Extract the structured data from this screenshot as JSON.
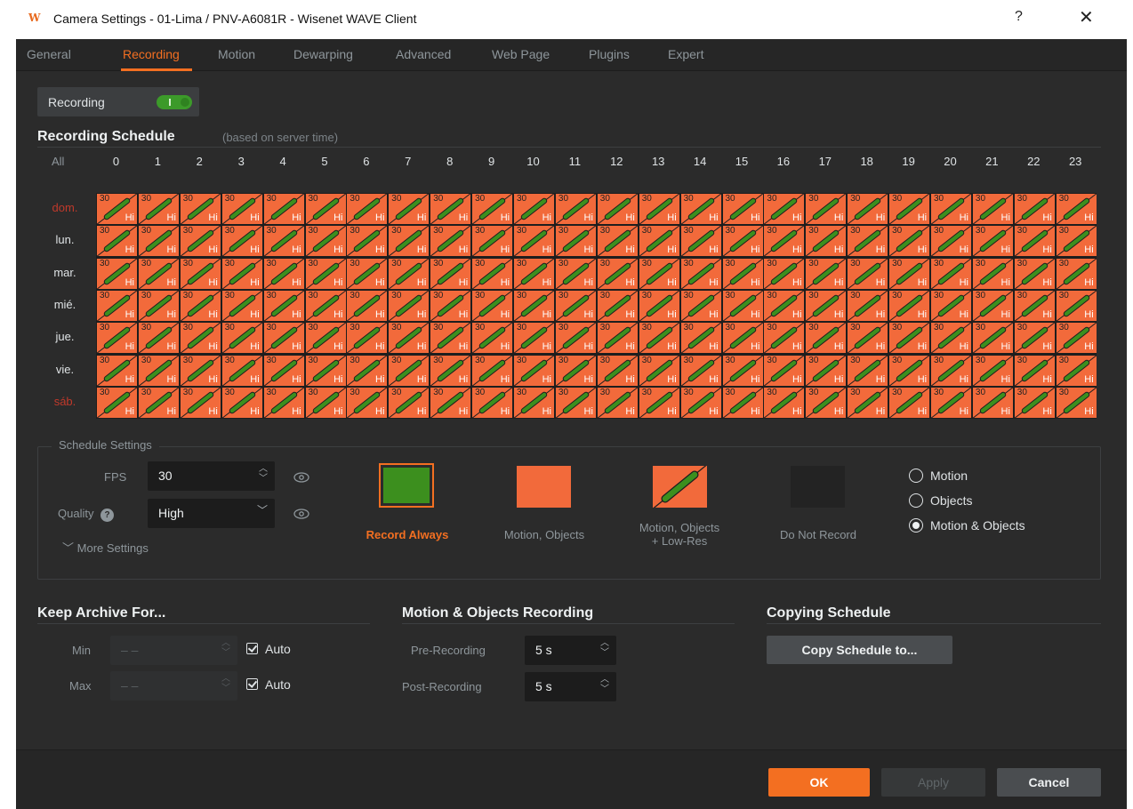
{
  "window": {
    "title": "Camera Settings - 01-Lima / PNV-A6081R - Wisenet WAVE Client",
    "app_icon": "W",
    "help_label": "?",
    "close_label": "✕"
  },
  "tabs": [
    {
      "label": "General",
      "active": false
    },
    {
      "label": "Recording",
      "active": true
    },
    {
      "label": "Motion",
      "active": false
    },
    {
      "label": "Dewarping",
      "active": false
    },
    {
      "label": "Advanced",
      "active": false
    },
    {
      "label": "Web Page",
      "active": false
    },
    {
      "label": "Plugins",
      "active": false
    },
    {
      "label": "Expert",
      "active": false
    }
  ],
  "recording_toggle": {
    "label": "Recording",
    "on": true
  },
  "schedule": {
    "title": "Recording Schedule",
    "subtitle": "(based on server time)",
    "all_label": "All",
    "hours": [
      "0",
      "1",
      "2",
      "3",
      "4",
      "5",
      "6",
      "7",
      "8",
      "9",
      "10",
      "11",
      "12",
      "13",
      "14",
      "15",
      "16",
      "17",
      "18",
      "19",
      "20",
      "21",
      "22",
      "23"
    ],
    "days": [
      {
        "label": "dom.",
        "weekend": true
      },
      {
        "label": "lun.",
        "weekend": false
      },
      {
        "label": "mar.",
        "weekend": false
      },
      {
        "label": "mié.",
        "weekend": false
      },
      {
        "label": "jue.",
        "weekend": false
      },
      {
        "label": "vie.",
        "weekend": false
      },
      {
        "label": "sáb.",
        "weekend": true
      }
    ],
    "cell": {
      "fps": "30",
      "quality": "Hi",
      "mode": "Motion, Objects + Low-Res"
    }
  },
  "schedule_settings": {
    "title": "Schedule Settings",
    "fps_label": "FPS",
    "fps_value": "30",
    "quality_label": "Quality",
    "quality_value": "High",
    "more_settings": "More Settings",
    "modes": [
      {
        "label": "Record Always",
        "selected": true
      },
      {
        "label": "Motion, Objects",
        "selected": false
      },
      {
        "label": "Motion, Objects\n+ Low-Res",
        "selected": false
      },
      {
        "label": "Do Not Record",
        "selected": false
      }
    ],
    "triggers": [
      {
        "label": "Motion",
        "checked": false
      },
      {
        "label": "Objects",
        "checked": false
      },
      {
        "label": "Motion & Objects",
        "checked": true
      }
    ]
  },
  "keep_archive": {
    "title": "Keep Archive For...",
    "min_label": "Min",
    "min_value": "– –",
    "max_label": "Max",
    "max_value": "– –",
    "auto_label": "Auto"
  },
  "motion_recording": {
    "title": "Motion & Objects Recording",
    "pre_label": "Pre-Recording",
    "pre_value": "5 s",
    "post_label": "Post-Recording",
    "post_value": "5 s"
  },
  "copying": {
    "title": "Copying Schedule",
    "button": "Copy Schedule to..."
  },
  "footer": {
    "ok": "OK",
    "apply": "Apply",
    "cancel": "Cancel"
  },
  "colors": {
    "accent": "#f36f21",
    "record_always": "#3c8f1e",
    "motion": "#f26a3b",
    "do_not_record": "#232323",
    "weekend": "#c0392b"
  }
}
